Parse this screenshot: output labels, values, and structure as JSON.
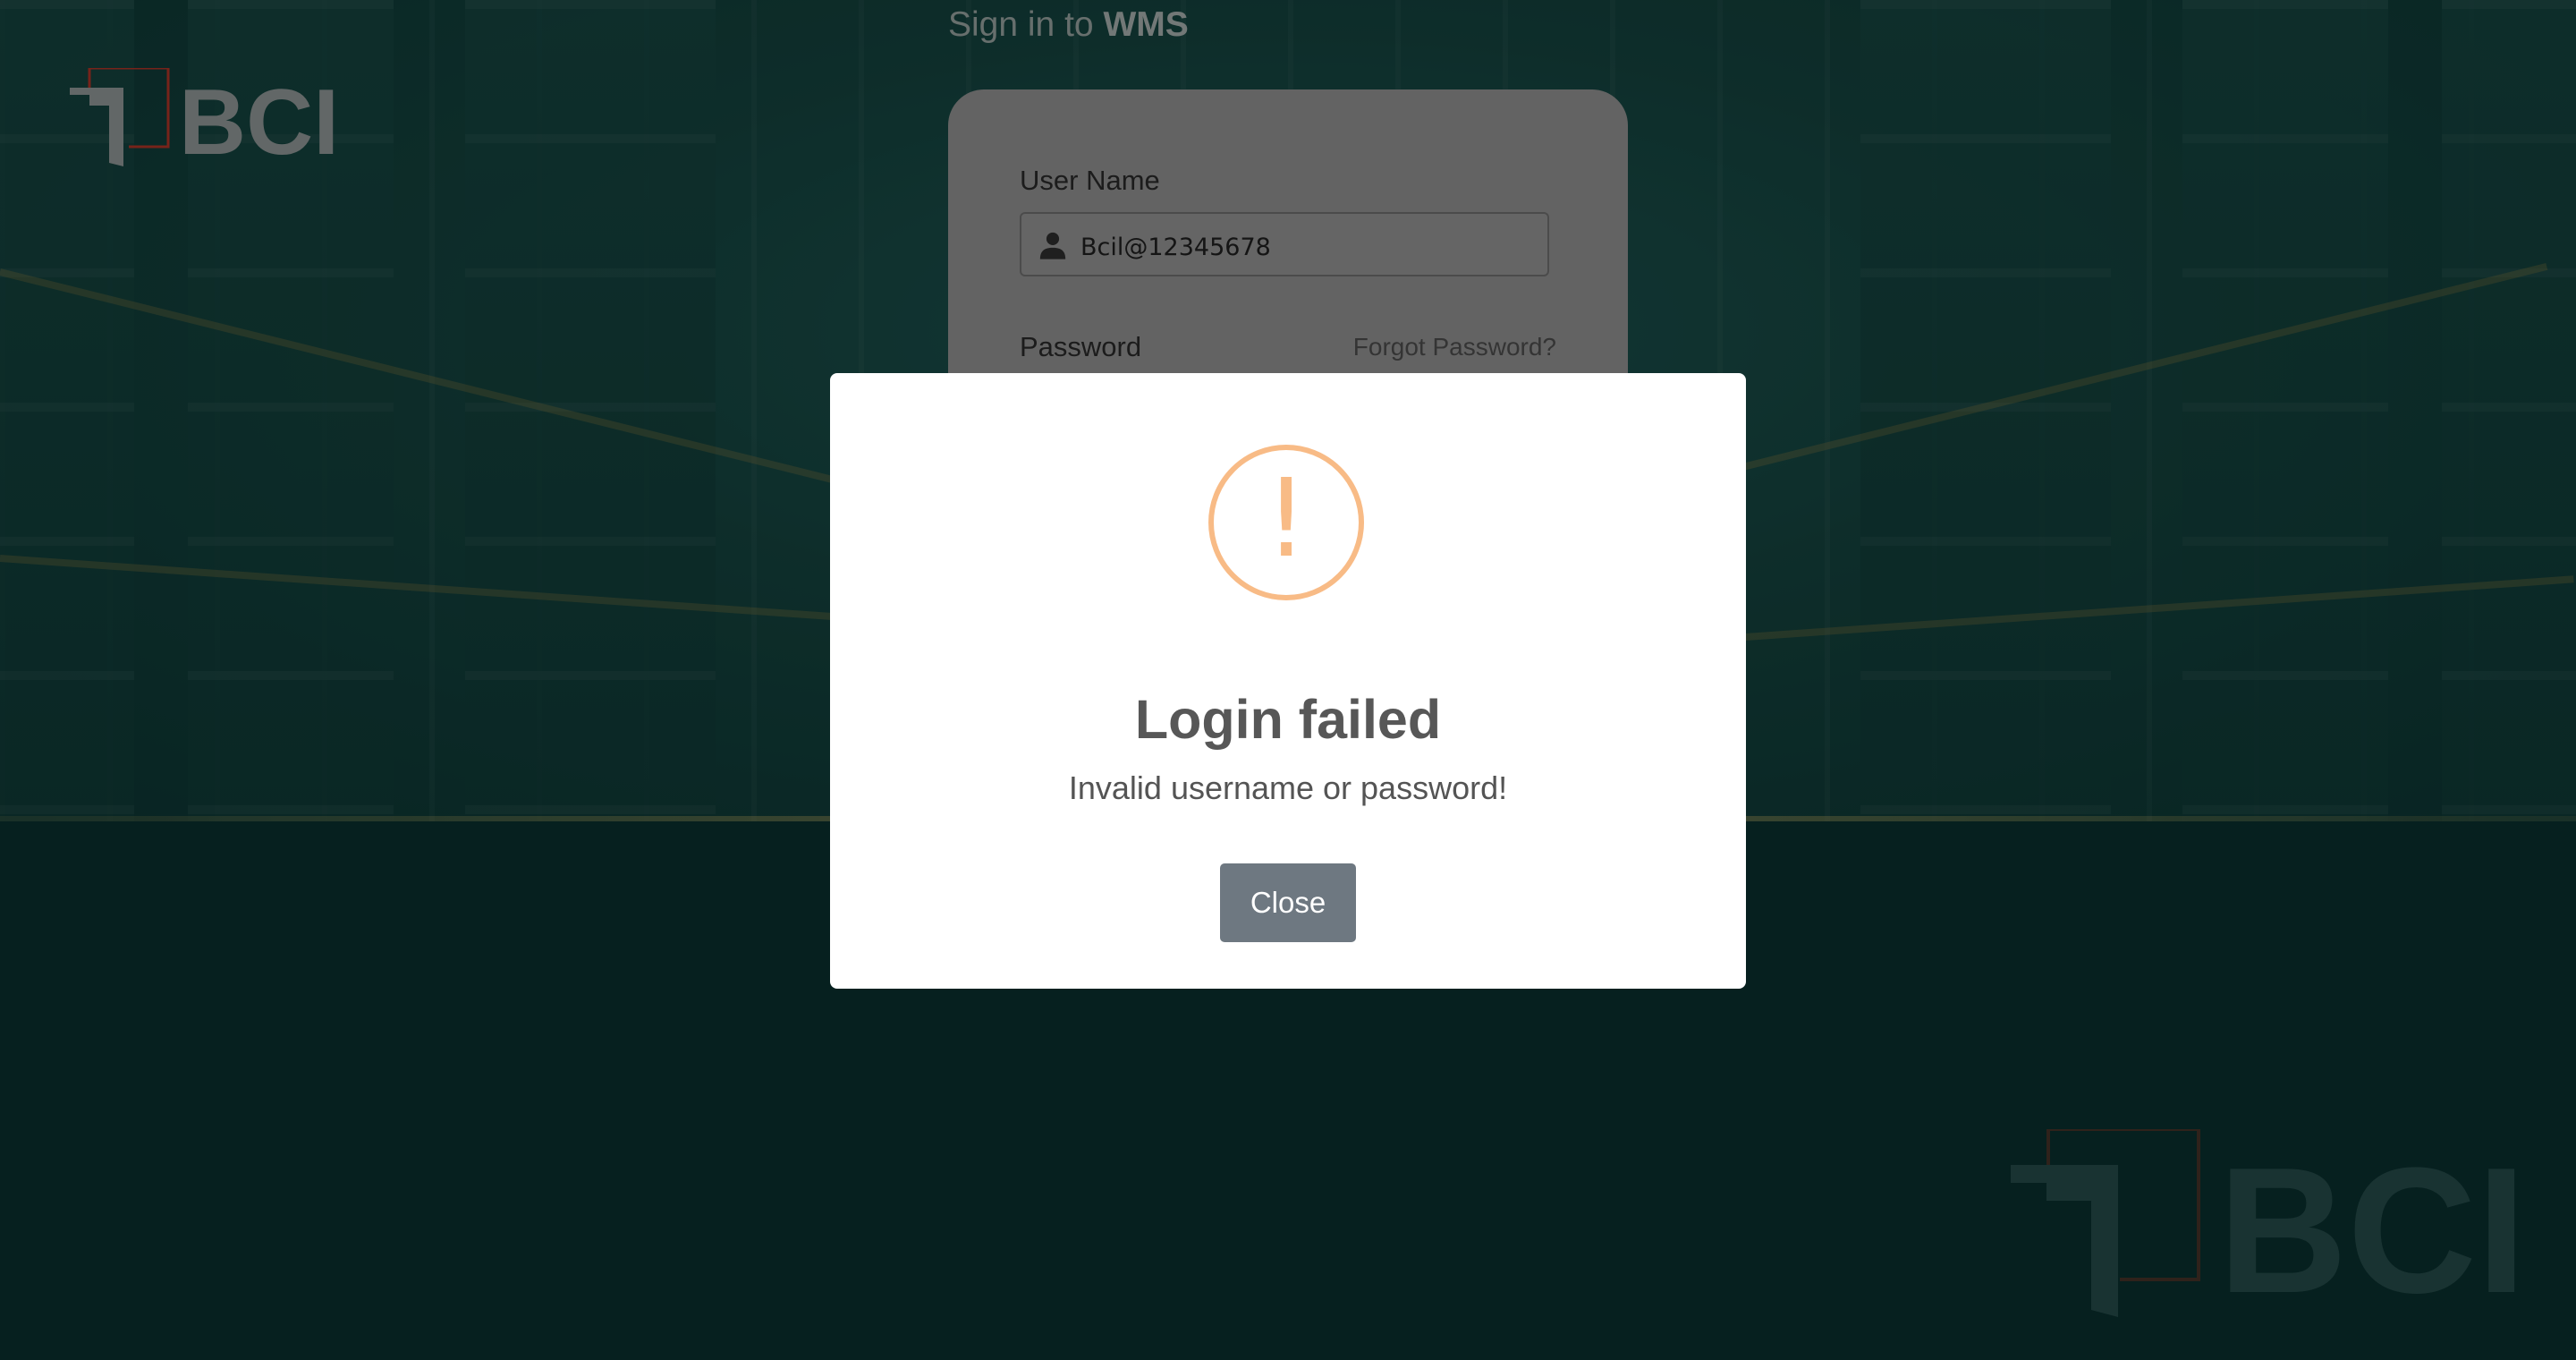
{
  "header": {
    "signin_prefix": "Sign in to",
    "app_name": "WMS"
  },
  "brand": {
    "logo_text": "BCI",
    "logo_accent_color": "#c0392b"
  },
  "login_form": {
    "username_label": "User Name",
    "username_value": "Bcil@12345678",
    "username_icon": "user-icon",
    "password_label": "Password",
    "forgot_password_label": "Forgot Password?"
  },
  "dialog": {
    "icon": "warning-icon",
    "icon_symbol": "!",
    "icon_color": "#f8bb86",
    "title": "Login failed",
    "message": "Invalid username or password!",
    "close_label": "Close",
    "close_button_color": "#6e7881"
  }
}
